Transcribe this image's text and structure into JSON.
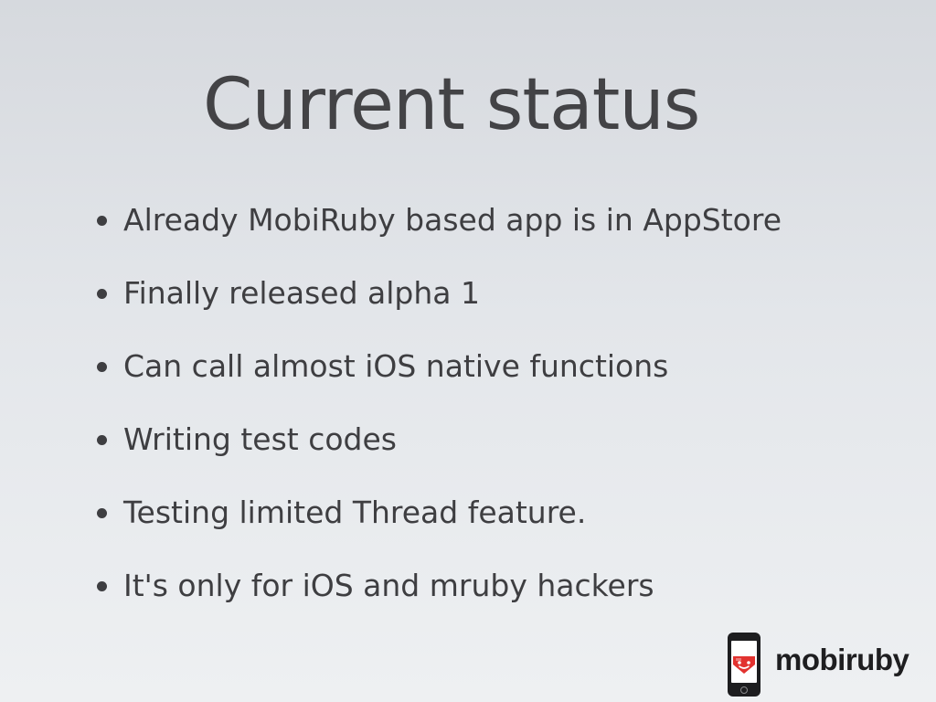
{
  "slide": {
    "title": "Current status",
    "bullets": [
      "Already MobiRuby based app is in AppStore",
      "Finally released alpha 1",
      "Can call almost iOS native functions",
      "Writing test codes",
      "Testing limited Thread feature.",
      "It's only for iOS and mruby hackers"
    ]
  },
  "logo": {
    "text": "mobiruby",
    "icon": "phone-ruby-face-icon",
    "accent_color": "#e2322f"
  },
  "colors": {
    "text": "#3e3e41",
    "background_top": "#d6d9de",
    "background_bottom": "#eef0f2"
  }
}
